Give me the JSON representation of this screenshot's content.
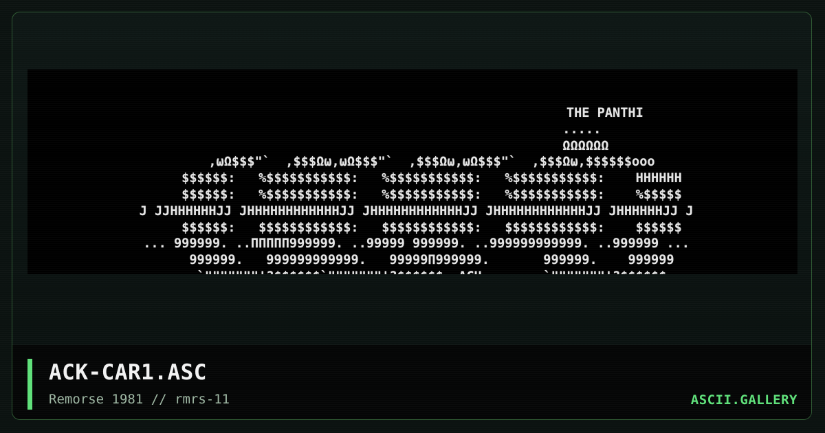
{
  "artwork": {
    "lines": "                                                  THE PANTHI\n                                            .....\n                                             ΩΩΩΩΩΩ\n     ,ωΩ$$$\"`  ,$$$Ωω,ωΩ$$$\"`  ,$$$Ωω,ωΩ$$$\"`  ,$$$Ωω,$$$$$$ooo\n     $$$$$$:   %$$$$$$$$$$$:   %$$$$$$$$$$$:   %$$$$$$$$$$$:    HHHHHH\n     $$$$$$:   %$$$$$$$$$$$:   %$$$$$$$$$$$:   %$$$$$$$$$$$:    %$$$$$\n J JJHHHHHHJJ JHHHHHHHHHHHHJJ JHHHHHHHHHHHHJJ JHHHHHHHHHHHHJJ JHHHHHHJJ J\n     $$$$$$:   $$$$$$$$$$$$:   $$$$$$$$$$$$:   $$$$$$$$$$$$:    $$$$$$\n ... 999999. ..ΠΠΠΠΠ999999. ..99999 999999. ..999999999999. ..999999 ...\n     999999.   999999999999.   99999Π999999.       999999.    999999\n     `\"\"\"\"\"\"\"'?$$$$$$`\"\"\"\"\"\"\"'?$$$$$$  ACH        `\"\"\"\"\"\"\"'?$$$$$$"
  },
  "footer": {
    "title": "ACK-CAR1.ASC",
    "subtitle": "Remorse 1981 // rmrs-11",
    "brand": "ASCII.GALLERY"
  },
  "colors": {
    "accent": "#5fe07a",
    "border": "#2f5a33",
    "background": "#0b1210"
  }
}
